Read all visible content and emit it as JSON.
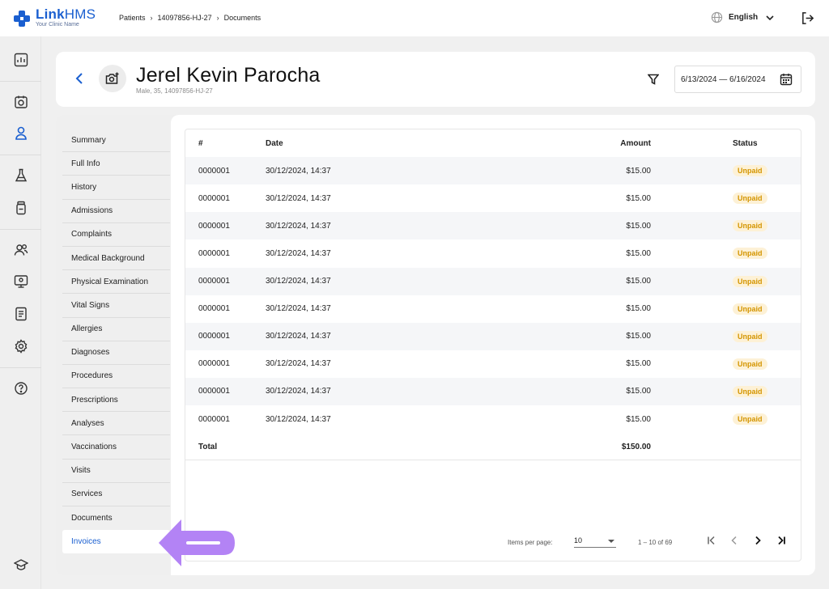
{
  "app": {
    "logo_name_bold": "Link",
    "logo_name_thin": "HMS",
    "logo_sub": "Your Clinic Name",
    "accent": "#1a5fd0"
  },
  "breadcrumb": [
    "Patients",
    "14097856-HJ-27",
    "Documents"
  ],
  "language": "English",
  "sidenav_icons": [
    "dashboard-icon",
    "calendar-icon",
    "patient-icon",
    "lab-flask-icon",
    "medicine-bottle-icon",
    "staff-icon",
    "monitor-icon",
    "report-icon",
    "settings-icon",
    "help-icon",
    "education-icon"
  ],
  "patient": {
    "name": "Jerel Kevin Parocha",
    "subtitle": "Male, 35, 14097856-HJ-27"
  },
  "date_range": "6/13/2024 — 6/16/2024",
  "menu": [
    "Summary",
    "Full Info",
    "History",
    "Admissions",
    "Complaints",
    "Medical Background",
    "Physical Examination",
    "Vital Signs",
    "Allergies",
    "Diagnoses",
    "Procedures",
    "Prescriptions",
    "Analyses",
    "Vaccinations",
    "Visits",
    "Services",
    "Documents",
    "Invoices"
  ],
  "active_menu": "Invoices",
  "table": {
    "headers": {
      "num": "#",
      "date": "Date",
      "amount": "Amount",
      "status": "Status"
    },
    "rows": [
      {
        "num": "0000001",
        "date": "30/12/2024, 14:37",
        "amount": "$15.00",
        "status": "Unpaid"
      },
      {
        "num": "0000001",
        "date": "30/12/2024, 14:37",
        "amount": "$15.00",
        "status": "Unpaid"
      },
      {
        "num": "0000001",
        "date": "30/12/2024, 14:37",
        "amount": "$15.00",
        "status": "Unpaid"
      },
      {
        "num": "0000001",
        "date": "30/12/2024, 14:37",
        "amount": "$15.00",
        "status": "Unpaid"
      },
      {
        "num": "0000001",
        "date": "30/12/2024, 14:37",
        "amount": "$15.00",
        "status": "Unpaid"
      },
      {
        "num": "0000001",
        "date": "30/12/2024, 14:37",
        "amount": "$15.00",
        "status": "Unpaid"
      },
      {
        "num": "0000001",
        "date": "30/12/2024, 14:37",
        "amount": "$15.00",
        "status": "Unpaid"
      },
      {
        "num": "0000001",
        "date": "30/12/2024, 14:37",
        "amount": "$15.00",
        "status": "Unpaid"
      },
      {
        "num": "0000001",
        "date": "30/12/2024, 14:37",
        "amount": "$15.00",
        "status": "Unpaid"
      },
      {
        "num": "0000001",
        "date": "30/12/2024, 14:37",
        "amount": "$15.00",
        "status": "Unpaid"
      }
    ],
    "total_label": "Total",
    "total_amount": "$150.00"
  },
  "pager": {
    "items_label": "Items per page:",
    "items_value": "10",
    "range": "1 – 10 of 69"
  },
  "colors": {
    "unpaid_bg": "#fdf1d6",
    "unpaid_text": "#d49500",
    "pointer_arrow": "#b383f5"
  }
}
